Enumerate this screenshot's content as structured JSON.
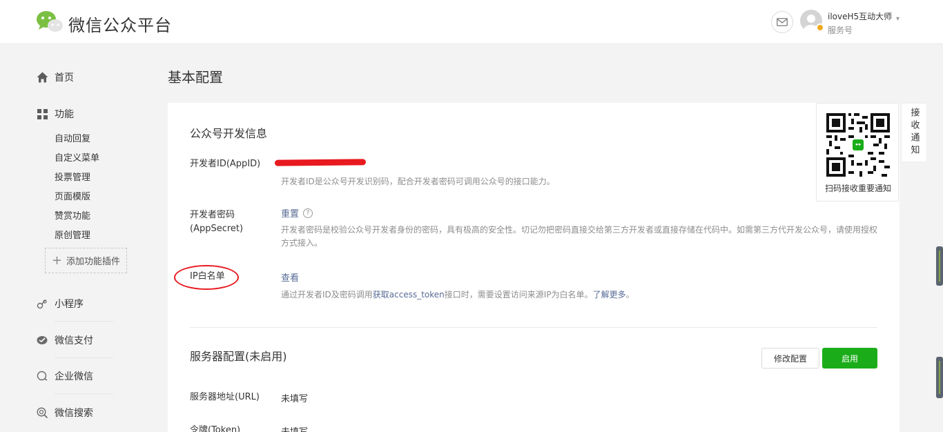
{
  "header": {
    "brand": "微信公众平台",
    "account_name": "iloveH5互动大师",
    "account_type": "服务号",
    "mail_icon": "mail-icon",
    "caret": "ˇ"
  },
  "sidebar": {
    "home": "首页",
    "features": "功能",
    "feature_items": [
      "自动回复",
      "自定义菜单",
      "投票管理",
      "页面模版",
      "赞赏功能",
      "原创管理"
    ],
    "add_plugin": "添加功能插件",
    "mini_program": "小程序",
    "wechat_pay": "微信支付",
    "work_wechat": "企业微信",
    "wechat_search": "微信搜索"
  },
  "main": {
    "page_title": "基本配置",
    "dev_info": {
      "title": "公众号开发信息",
      "appid_label": "开发者ID(AppID)",
      "appid_desc": "开发者ID是公众号开发识别码，配合开发者密码可调用公众号的接口能力。",
      "secret_label_1": "开发者密码",
      "secret_label_2": "(AppSecret)",
      "secret_action": "重置",
      "secret_help": "?",
      "secret_desc": "开发者密码是校验公众号开发者身份的密码，具有极高的安全性。切记勿把密码直接交给第三方开发者或直接存储在代码中。如需第三方代开发公众号，请使用授权方式接入。",
      "ip_label": "IP白名单",
      "ip_action": "查看",
      "ip_desc_pre": "通过开发者ID及密码调用",
      "ip_desc_link": "获取access_token",
      "ip_desc_mid": "接口时，需要设置访问来源IP为白名单。",
      "ip_desc_more": "了解更多",
      "ip_desc_end": "。"
    },
    "server": {
      "title": "服务器配置(未启用)",
      "edit_button": "修改配置",
      "enable_button": "启用",
      "url_label": "服务器地址(URL)",
      "url_value": "未填写",
      "token_label": "令牌(Token)",
      "token_value": "未填写"
    }
  },
  "qr_panel": {
    "caption": "扫码接收重要通知",
    "notice_tab": "接收通知"
  },
  "colors": {
    "primary_green": "#1aad19",
    "link_blue": "#576b95",
    "annotation_red": "#e8191f"
  }
}
